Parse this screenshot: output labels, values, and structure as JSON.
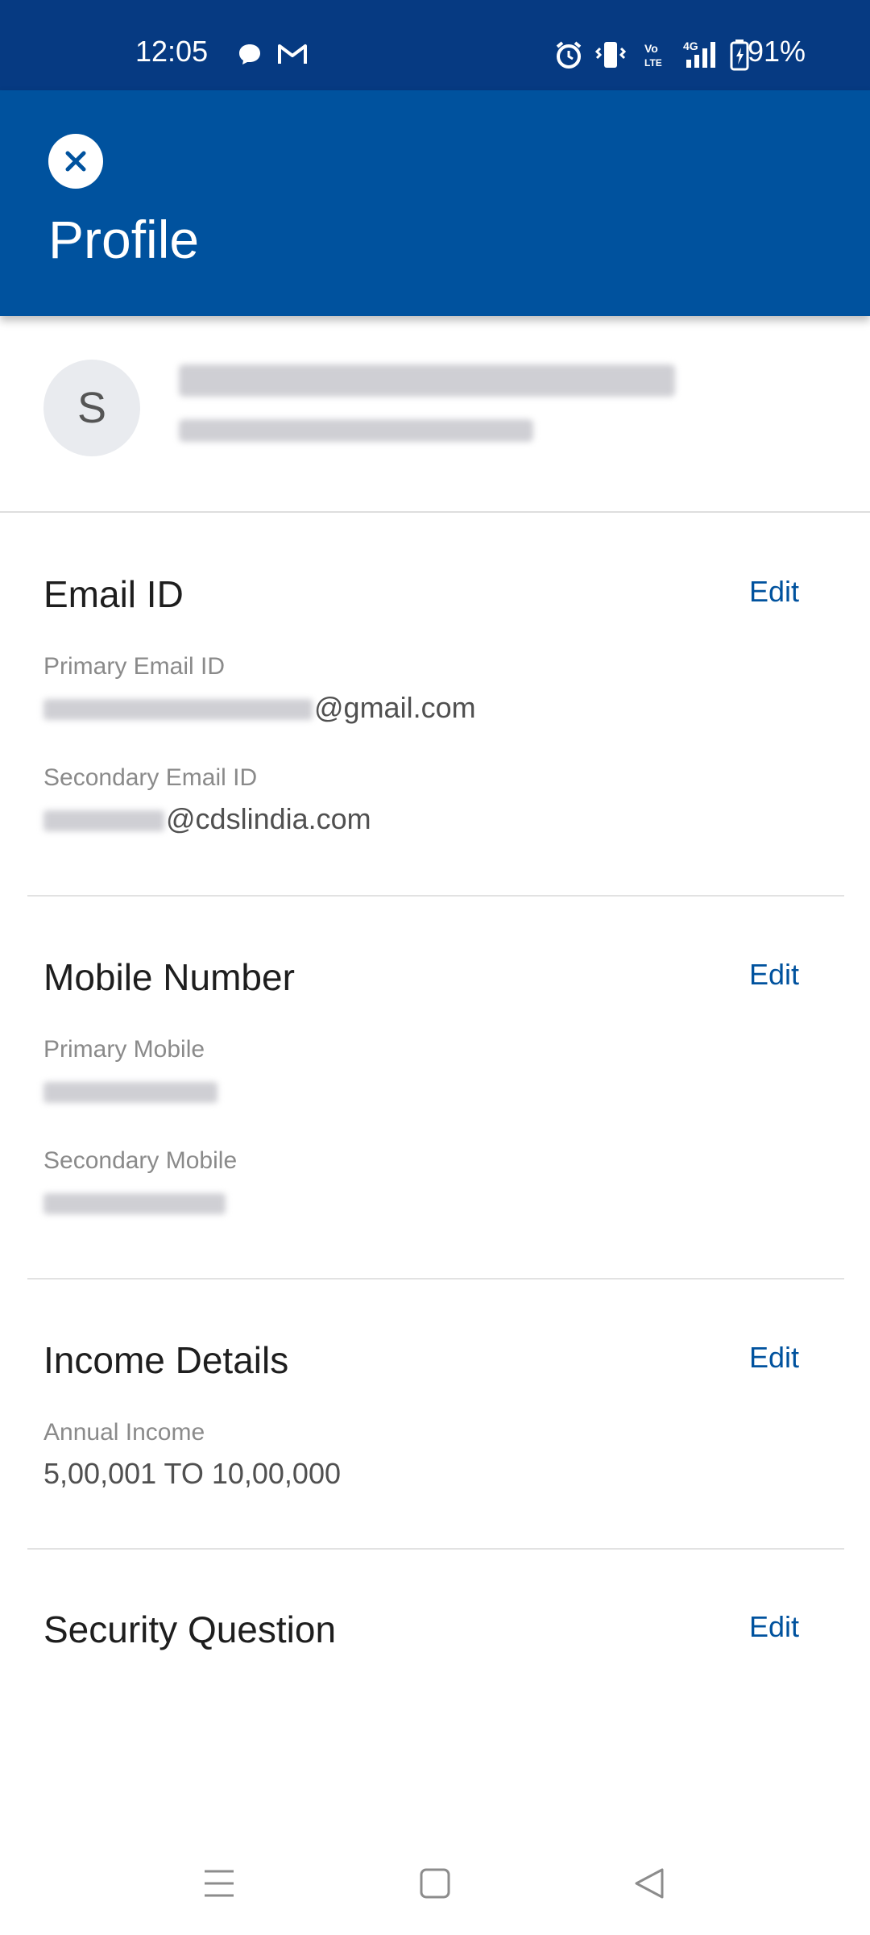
{
  "status_bar": {
    "time": "12:05",
    "battery": "91%",
    "icons": [
      "chat-icon",
      "gmail-icon",
      "alarm-icon",
      "vibrate-icon",
      "volte-icon",
      "signal-4g-icon",
      "battery-icon"
    ]
  },
  "header": {
    "title": "Profile",
    "close_icon": "close-icon"
  },
  "profile": {
    "avatar_letter": "S"
  },
  "email_section": {
    "title": "Email ID",
    "edit": "Edit",
    "primary_label": "Primary Email ID",
    "primary_value_suffix": "@gmail.com",
    "secondary_label": "Secondary Email ID",
    "secondary_value_suffix": "@cdslindia.com"
  },
  "mobile_section": {
    "title": "Mobile Number",
    "edit": "Edit",
    "primary_label": "Primary Mobile",
    "secondary_label": "Secondary Mobile"
  },
  "income_section": {
    "title": "Income Details",
    "edit": "Edit",
    "annual_label": "Annual Income",
    "annual_value": "5,00,001 TO 10,00,000"
  },
  "security_section": {
    "title": "Security Question",
    "edit": "Edit"
  },
  "colors": {
    "status_bar": "#063a82",
    "header": "#00529e",
    "accent": "#00529e"
  }
}
